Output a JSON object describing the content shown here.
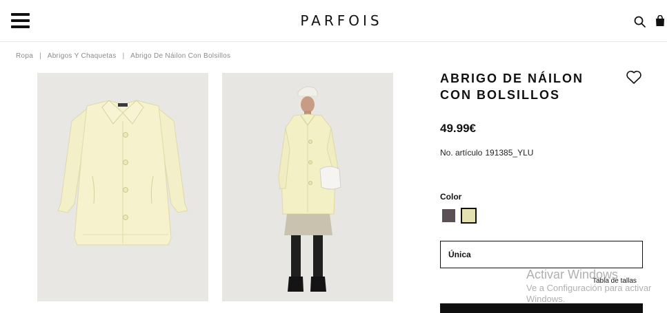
{
  "header": {
    "logo": "PARFOIS",
    "menu_icon": "hamburger-menu-icon",
    "search_icon": "search-icon",
    "bag_icon": "shopping-bag-icon"
  },
  "breadcrumb": {
    "items": [
      "Ropa",
      "Abrigos Y Chaquetas",
      "Abrigo De Náilon Con Bolsillos"
    ],
    "separator": "|"
  },
  "gallery": {
    "images": [
      {
        "description": "product-flat-coat-image"
      },
      {
        "description": "model-wearing-coat-image"
      }
    ]
  },
  "product": {
    "title_line1": "ABRIGO DE NÁILON",
    "title_line2": "CON BOLSILLOS",
    "price": "49.99€",
    "sku_label": "No. artículo",
    "sku_value": "191385_YLU",
    "color_label": "Color",
    "colors": [
      {
        "hex": "#5b5056",
        "selected": false
      },
      {
        "hex": "#e4e2b2",
        "selected": true
      }
    ],
    "size_selected": "Única",
    "size_table_link": "Tabla de tallas",
    "wishlist_icon": "heart-icon"
  },
  "overlay": {
    "watermark_title": "Activar Windows",
    "watermark_sub": "Ve a Configuración para activar Windows."
  }
}
